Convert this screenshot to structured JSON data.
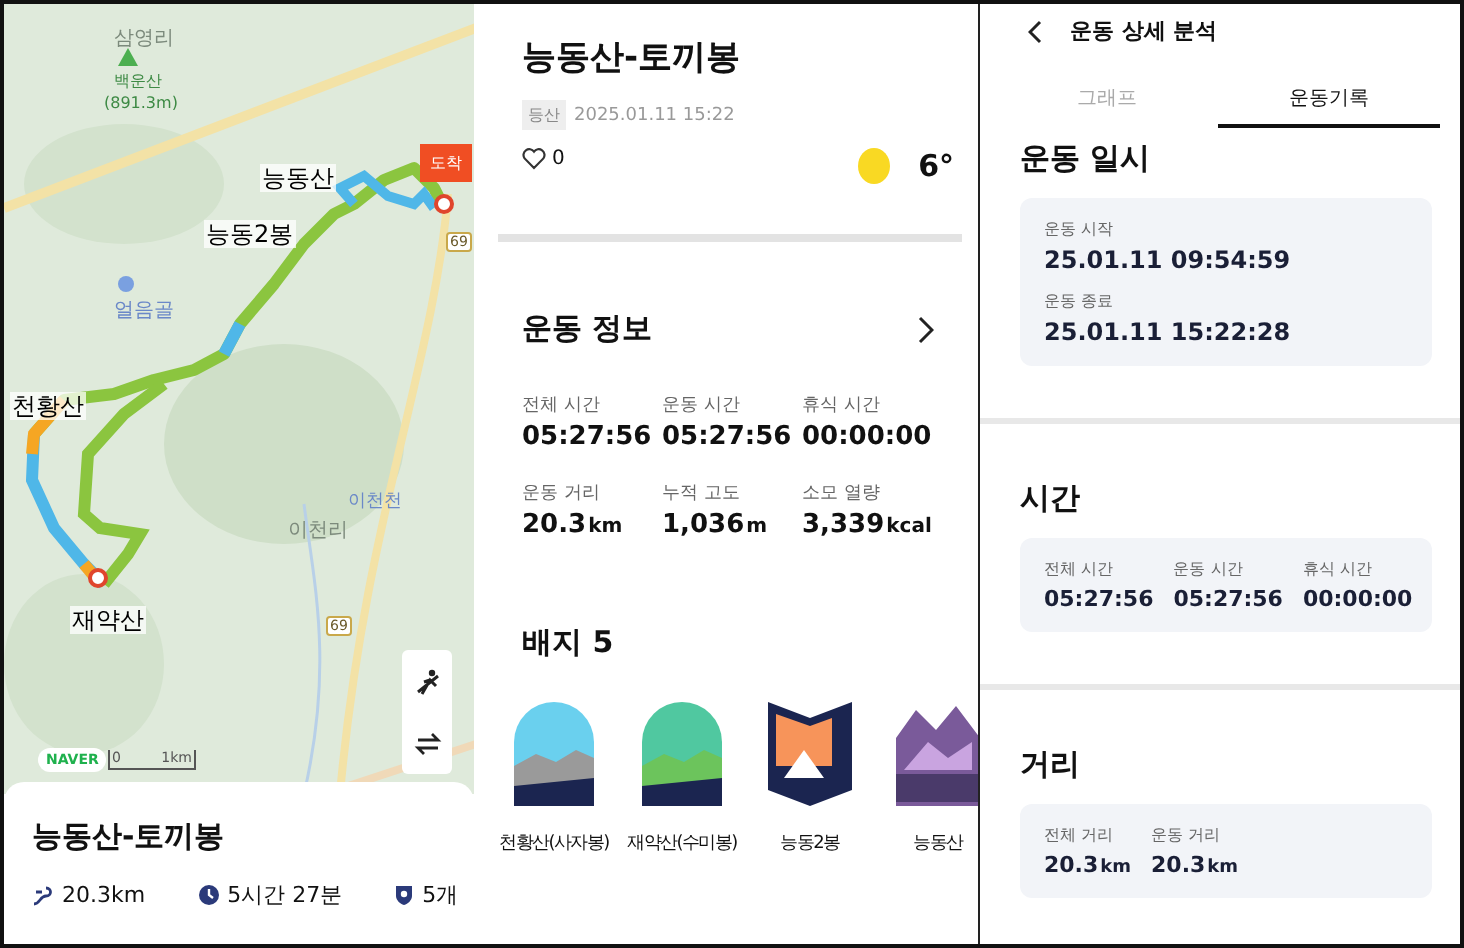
{
  "map": {
    "places": [
      {
        "text": "삼영리",
        "kind": "village"
      },
      {
        "text": "백운산",
        "kind": "peak"
      },
      {
        "text": "(891.3m)",
        "kind": "height"
      },
      {
        "text": "얼음골",
        "kind": "spot"
      },
      {
        "text": "이천리",
        "kind": "village"
      },
      {
        "text": "이천천",
        "kind": "stream"
      }
    ],
    "road_numbers": [
      "69",
      "69"
    ],
    "route_labels": [
      "능동산",
      "능동2봉",
      "천황산",
      "재약산"
    ],
    "end_marker": "도착",
    "brand": "NAVER",
    "scale": [
      "0",
      "1km"
    ]
  },
  "summary": {
    "title": "능동산-토끼봉",
    "stats": [
      {
        "kind": "distance",
        "text": "20.3km"
      },
      {
        "kind": "time",
        "text": "5시간 27분"
      },
      {
        "kind": "badge",
        "text": "5개"
      }
    ]
  },
  "record": {
    "title": "능동산-토끼봉",
    "tag": "등산",
    "date": "2025.01.11 15:22",
    "likes": "0",
    "weather": {
      "kind": "sunny",
      "temp": "6°"
    },
    "info_title": "운동 정보",
    "stats": [
      {
        "label": "전체 시간",
        "value": "05:27:56"
      },
      {
        "label": "운동 시간",
        "value": "05:27:56"
      },
      {
        "label": "휴식 시간",
        "value": "00:00:00"
      },
      {
        "label": "운동 거리",
        "value": "20.3",
        "unit": "km"
      },
      {
        "label": "누적 고도",
        "value": "1,036",
        "unit": "m"
      },
      {
        "label": "소모 열량",
        "value": "3,339",
        "unit": "kcal"
      }
    ],
    "badges_title": "배지 5",
    "badges": [
      {
        "name": "천황산(사자봉)",
        "kind": "rock"
      },
      {
        "name": "재약산(수미봉)",
        "kind": "forest"
      },
      {
        "name": "능동2봉",
        "kind": "park"
      },
      {
        "name": "능동산",
        "kind": "peak"
      }
    ]
  },
  "detail": {
    "title": "운동 상세 분석",
    "tabs": [
      {
        "label": "그래프",
        "selected": false
      },
      {
        "label": "운동기록",
        "selected": true
      }
    ],
    "sections": [
      {
        "title": "운동 일시",
        "kind": "dates",
        "items": [
          {
            "label": "운동 시작",
            "value": "25.01.11 09:54:59"
          },
          {
            "label": "운동 종료",
            "value": "25.01.11 15:22:28"
          }
        ]
      },
      {
        "title": "시간",
        "kind": "stats",
        "items": [
          {
            "label": "전체 시간",
            "value": "05:27:56"
          },
          {
            "label": "운동 시간",
            "value": "05:27:56"
          },
          {
            "label": "휴식 시간",
            "value": "00:00:00"
          }
        ]
      },
      {
        "title": "거리",
        "kind": "stats",
        "items": [
          {
            "label": "전체 거리",
            "value": "20.3",
            "unit": "km"
          },
          {
            "label": "운동 거리",
            "value": "20.3",
            "unit": "km"
          }
        ]
      }
    ]
  }
}
